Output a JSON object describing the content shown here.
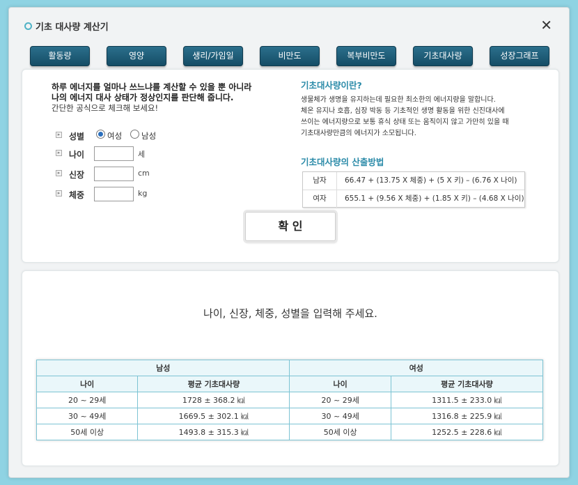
{
  "window": {
    "title": "기초 대사량 계산기"
  },
  "tabs": [
    "활동량",
    "영양",
    "생리/가임일",
    "비만도",
    "복부비만도",
    "기초대사량",
    "성장그래프"
  ],
  "intro": {
    "line1": "하루 에너지를 얼마나 쓰느냐를 계산할 수 있을 뿐 아니라",
    "line2": "나의 에너지 대사 상태가 정상인지를 판단해 줍니다.",
    "line3": "간단한 공식으로 체크해 보세요!"
  },
  "form": {
    "sex_label": "성별",
    "female": "여성",
    "male": "남성",
    "selected": "여성",
    "age_label": "나이",
    "age_unit": "세",
    "height_label": "신장",
    "height_unit": "cm",
    "weight_label": "체중",
    "weight_unit": "kg",
    "age_value": "",
    "height_value": "",
    "weight_value": ""
  },
  "info": {
    "title": "기초대사량이란?",
    "desc1": "생물체가 생명을 유지하는데 필요한 최소한의 에너지량을 말합니다.",
    "desc2": "체온 유지나 호흡, 심장 박동 등 기초적인 생명 활동을 위한 신진대사에",
    "desc3": "쓰이는 에너지량으로 보통 휴식 상태 또는 움직이지 않고 가만히 있을 때",
    "desc4": "기초대사량만큼의 에너지가 소모됩니다.",
    "method_title": "기초대사량의 산출방법",
    "male_label": "남자",
    "male_formula": "66.47 + (13.75 X 체중) + (5 X 키) – (6.76 X 나이)",
    "female_label": "여자",
    "female_formula": "655.1 + (9.56 X 체중) + (1.85 X 키) – (4.68 X 나이)"
  },
  "confirm_label": "확 인",
  "result": {
    "prompt": "나이, 신장, 체중, 성별을 입력해 주세요.",
    "male_header": "남성",
    "female_header": "여성",
    "age_col": "나이",
    "avg_col": "평균 기초대사량",
    "rows": [
      {
        "age": "20 ~ 29세",
        "male": "1728 ± 368.2 ㎉",
        "female": "1311.5 ± 233.0 ㎉"
      },
      {
        "age": "30 ~ 49세",
        "male": "1669.5 ± 302.1 ㎉",
        "female": "1316.8 ± 225.9 ㎉"
      },
      {
        "age": "50세 이상",
        "male": "1493.8 ± 315.3 ㎉",
        "female": "1252.5 ± 228.6 ㎉"
      }
    ]
  }
}
